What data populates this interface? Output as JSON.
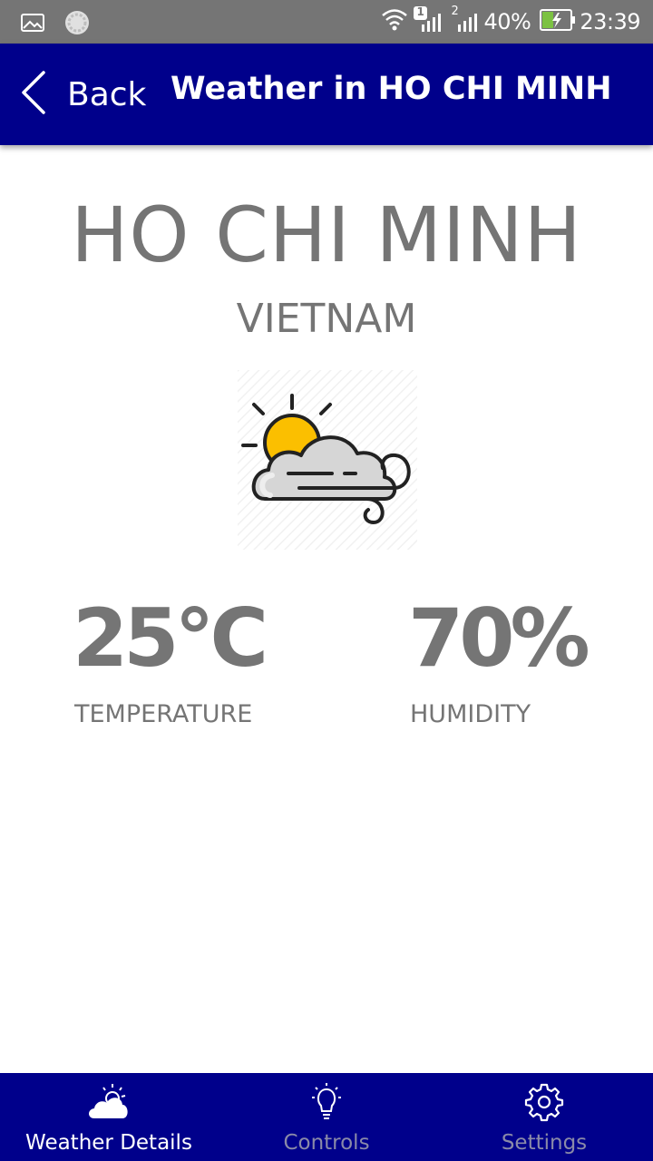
{
  "status_bar": {
    "battery_percent": "40%",
    "time": "23:39",
    "sim1_badge": "1",
    "sim2_badge": "2",
    "icons": [
      "gallery-notification-icon",
      "app-notification-icon",
      "wifi-icon",
      "signal-sim1-icon",
      "signal-sim2-icon",
      "battery-charging-icon"
    ]
  },
  "app_bar": {
    "back_label": "Back",
    "title": "Weather in HO CHI MINH"
  },
  "weather": {
    "city": "HO CHI MINH",
    "country": "VIETNAM",
    "condition_icon": "partly-cloudy-windy-icon",
    "temperature": "25°C",
    "temperature_label": "TEMPERATURE",
    "humidity": "70%",
    "humidity_label": "HUMIDITY"
  },
  "bottom_nav": {
    "items": [
      {
        "label": "Weather Details",
        "icon": "cloud-sun-icon",
        "active": true
      },
      {
        "label": "Controls",
        "icon": "lightbulb-icon",
        "active": false
      },
      {
        "label": "Settings",
        "icon": "gear-icon",
        "active": false
      }
    ]
  },
  "colors": {
    "status_bar": "#757575",
    "primary": "#00008b",
    "text_gray": "#757575",
    "sun_yellow": "#fbbf00",
    "inactive_nav": "#8a8aa8"
  }
}
